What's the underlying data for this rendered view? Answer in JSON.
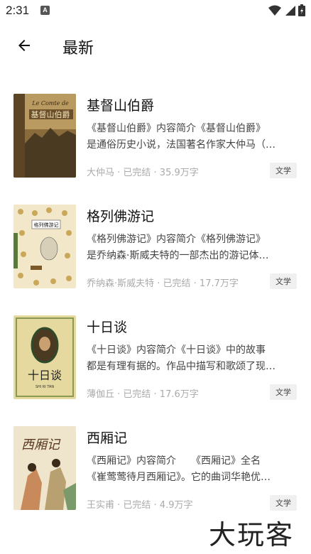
{
  "status_bar": {
    "time": "2:31",
    "notification_icon": "A"
  },
  "app_bar": {
    "title": "最新"
  },
  "books": [
    {
      "title": "基督山伯爵",
      "desc_line1": "《基督山伯爵》内容简介《基督山伯爵》",
      "desc_line2": "是通俗历史小说，法国著名作家大仲马（…",
      "meta": "大仲马 · 已完结 · 35.9万字",
      "tag": "文学",
      "cover_icon": "book-cover-count-of-monte-cristo"
    },
    {
      "title": "格列佛游记",
      "desc_line1": "《格列佛游记》内容简介《格列佛游记》",
      "desc_line2": "是乔纳森·斯威夫特的一部杰出的游记体…",
      "meta": "乔纳森·斯威夫特 · 已完结 · 17.7万字",
      "tag": "文学",
      "cover_icon": "book-cover-gullivers-travels"
    },
    {
      "title": "十日谈",
      "desc_line1": "《十日谈》内容简介《十日谈》中的故事",
      "desc_line2": "都是有理有据的。作品中描写和歌颂了现…",
      "meta": "薄伽丘 · 已完结 · 17.6万字",
      "tag": "文学",
      "cover_icon": "book-cover-decameron"
    },
    {
      "title": "西厢记",
      "desc_line1": "《西厢记》内容简介　　《西厢记》全名",
      "desc_line2": "《崔莺莺待月西厢记》。它的曲词华艳优…",
      "meta": "王实甫 · 已完结 · 4.9万字",
      "tag": "文学",
      "cover_icon": "book-cover-west-chamber"
    }
  ],
  "watermark": "大玩客"
}
